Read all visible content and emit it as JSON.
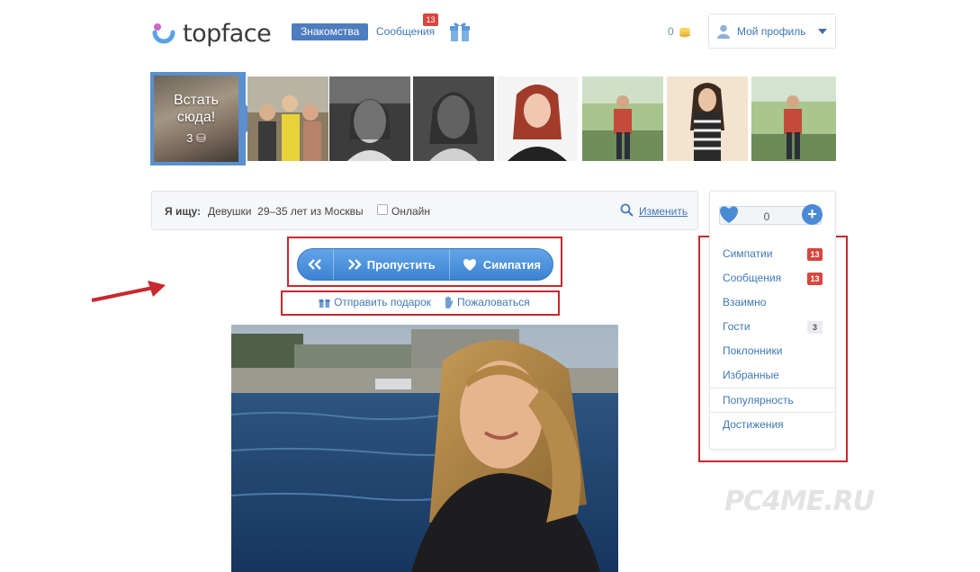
{
  "header": {
    "logo_text": "topface",
    "nav_dating": "Знакомства",
    "nav_messages": "Сообщения",
    "messages_badge": "13",
    "coins": "0",
    "profile_label": "Мой профиль"
  },
  "strip": {
    "stand_here": "Встать сюда!",
    "stand_here_cost": "3"
  },
  "search": {
    "label": "Я ищу:",
    "value": "Девушки  29–35 лет из Москвы",
    "online_label": "Онлайн",
    "change_link": "Изменить"
  },
  "actions": {
    "skip": "Пропустить",
    "like": "Симпатия",
    "gift": "Отправить подарок",
    "report": "Пожаловаться"
  },
  "sidebar": {
    "likes_count": "0",
    "items": [
      {
        "label": "Симпатии",
        "badge": "13",
        "badge_style": "red"
      },
      {
        "label": "Сообщения",
        "badge": "13",
        "badge_style": "red"
      },
      {
        "label": "Взаимно",
        "badge": ""
      },
      {
        "label": "Гости",
        "badge": "3",
        "badge_style": "grey"
      },
      {
        "label": "Поклонники",
        "badge": ""
      },
      {
        "label": "Избранные",
        "badge": ""
      },
      {
        "label": "Популярность",
        "badge": ""
      },
      {
        "label": "Достижения",
        "badge": ""
      }
    ]
  },
  "watermark": "PC4ME.RU",
  "colors": {
    "accent": "#4a8bd6",
    "link": "#3f78b6",
    "badge_red": "#d9453d",
    "highlight_red": "#c8282e"
  }
}
